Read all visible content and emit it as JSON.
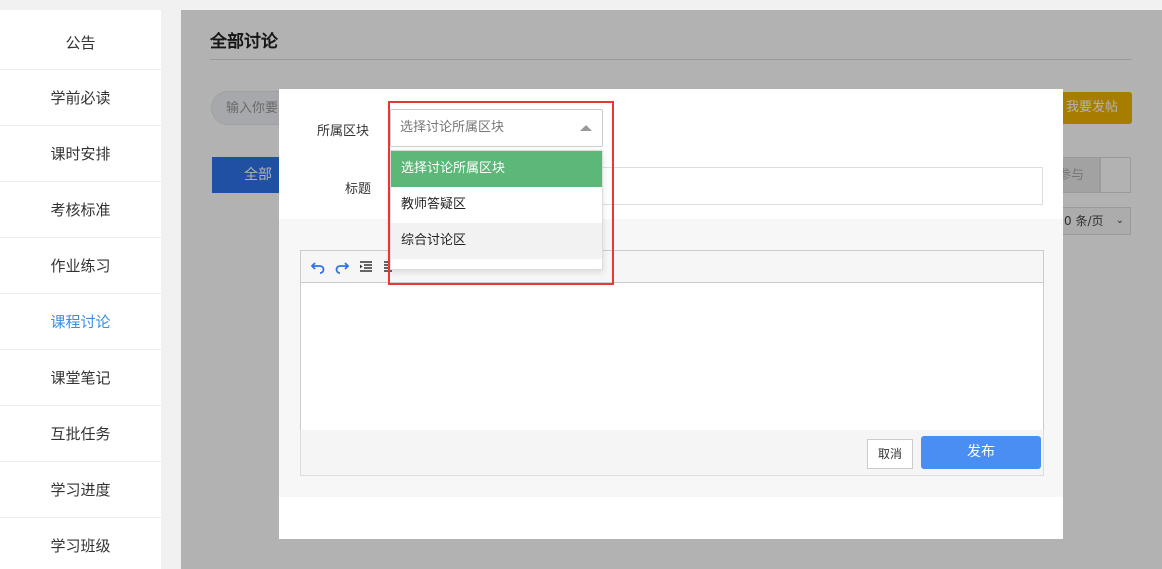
{
  "sidebar": {
    "items": [
      {
        "label": "公告"
      },
      {
        "label": "学前必读"
      },
      {
        "label": "课时安排"
      },
      {
        "label": "考核标准"
      },
      {
        "label": "作业练习"
      },
      {
        "label": "课程讨论",
        "active": true
      },
      {
        "label": "课堂笔记"
      },
      {
        "label": "互批任务"
      },
      {
        "label": "学习进度"
      },
      {
        "label": "学习班级"
      }
    ]
  },
  "main": {
    "title": "全部讨论",
    "search_placeholder": "输入你要",
    "post_button": "我要发帖",
    "tab_all": "全部",
    "tab_join": "参与",
    "page_size": "0 条/页"
  },
  "modal": {
    "block_label": "所属区块",
    "title_label": "标题",
    "select_placeholder": "选择讨论所属区块",
    "dropdown_options": [
      "选择讨论所属区块",
      "教师答疑区",
      "综合讨论区"
    ],
    "cancel_button": "取消",
    "publish_button": "发布"
  },
  "colors": {
    "accent": "#3a8ee6",
    "selected_option": "#5cb878",
    "publish": "#4a8ef3",
    "highlight": "#e53935"
  }
}
